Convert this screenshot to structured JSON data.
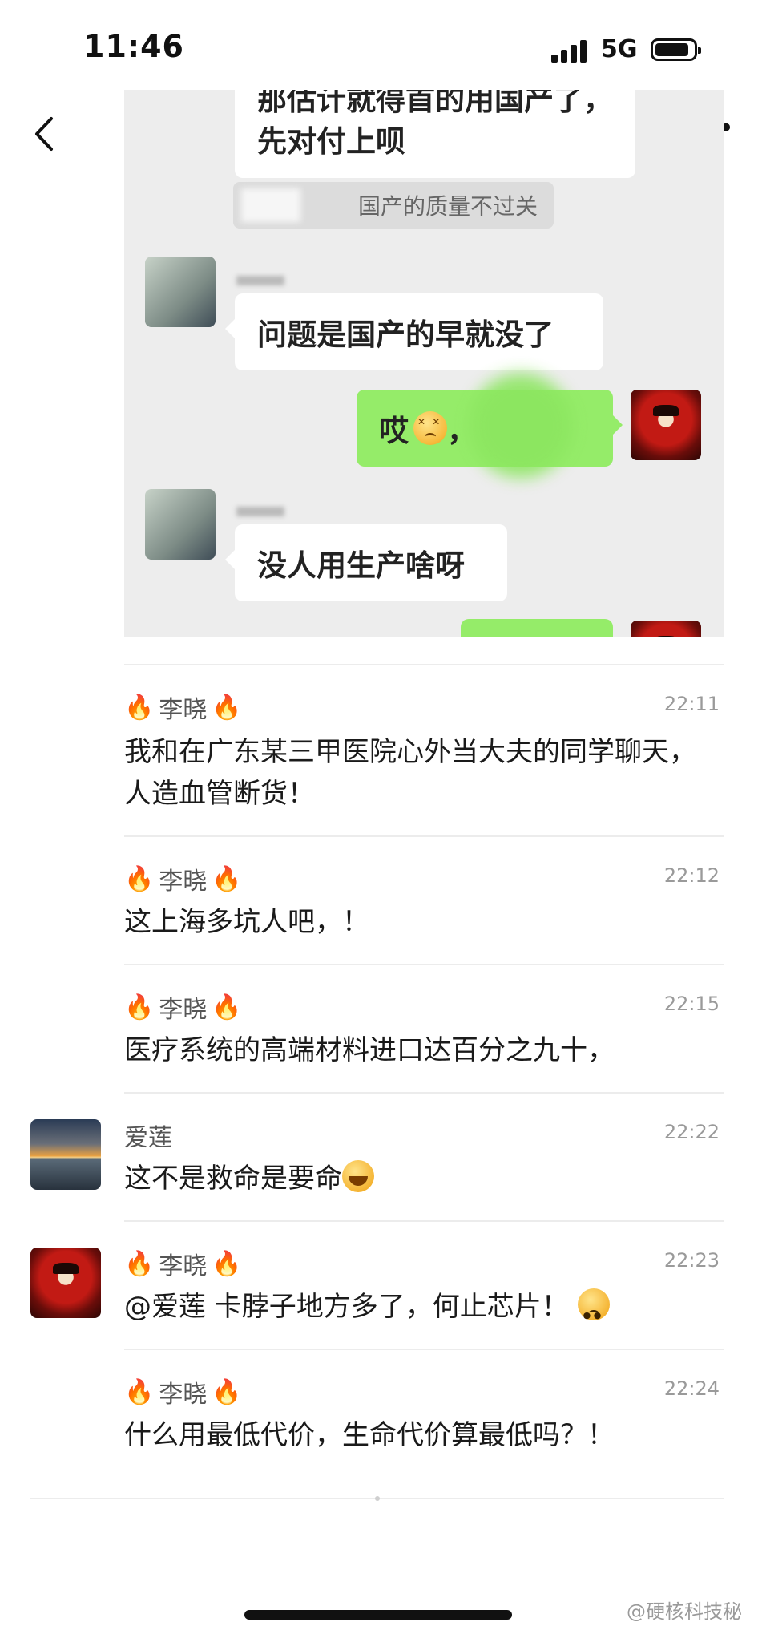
{
  "status_bar": {
    "time": "11:46",
    "network": "5G"
  },
  "embedded_chat": {
    "partial_top_text": "那估计就得首的用国产了，",
    "bubble_1": "先对付上呗",
    "system_note": "国产的质量不过关",
    "bubble_2": "问题是国产的早就没了",
    "bubble_3_text": "哎",
    "bubble_3_suffix": "，",
    "bubble_4": "没人用生产啥呀"
  },
  "comments": [
    {
      "name": "李晓",
      "fire": "🔥",
      "time": "22:11",
      "text": "我和在广东某三甲医院心外当大夫的同学聊天，人造血管断货！"
    },
    {
      "name": "李晓",
      "fire": "🔥",
      "time": "22:12",
      "text": "这上海多坑人吧，！"
    },
    {
      "name": "李晓",
      "fire": "🔥",
      "time": "22:15",
      "text": "医疗系统的高端材料进口达百分之九十，"
    },
    {
      "name": "爱莲",
      "time": "22:22",
      "text": "这不是救命是要命"
    },
    {
      "name": "李晓",
      "fire": "🔥",
      "time": "22:23",
      "text": "@爱莲 卡脖子地方多了，何止芯片！"
    },
    {
      "name": "李晓",
      "fire": "🔥",
      "time": "22:24",
      "text": "什么用最低代价，生命代价算最低吗？！"
    }
  ],
  "watermark": "@硬核科技秘",
  "icons": {
    "back": "chevron-left-icon",
    "more": "more-icon",
    "fire": "fire-icon"
  }
}
